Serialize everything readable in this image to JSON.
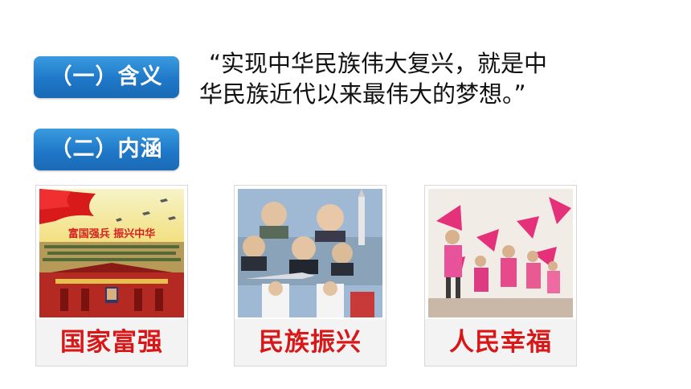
{
  "sections": [
    {
      "label": "（一）含义"
    },
    {
      "label": "（二）内涵"
    }
  ],
  "quote": {
    "line1": "“实现中华民族伟大复兴，就是中",
    "line2": "华民族近代以来最伟大的梦想。”"
  },
  "cards": [
    {
      "caption": "国家富强",
      "banner_text": "富国强兵  振兴中华"
    },
    {
      "caption": "民族振兴"
    },
    {
      "caption": "人民幸福"
    }
  ],
  "colors": {
    "pill_blue": "#1f78c8",
    "caption_red": "#d81818"
  }
}
